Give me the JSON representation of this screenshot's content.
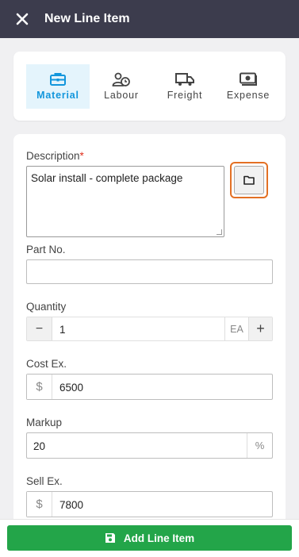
{
  "header": {
    "title": "New Line Item"
  },
  "types": {
    "active": "Material",
    "items": [
      {
        "label": "Material",
        "icon": "toolbox-icon"
      },
      {
        "label": "Labour",
        "icon": "worker-clock-icon"
      },
      {
        "label": "Freight",
        "icon": "truck-icon"
      },
      {
        "label": "Expense",
        "icon": "money-icon"
      }
    ]
  },
  "form": {
    "description": {
      "label": "Description",
      "required_mark": "*",
      "value": "Solar install - complete package"
    },
    "part_no": {
      "label": "Part No.",
      "value": ""
    },
    "quantity": {
      "label": "Quantity",
      "value": "1",
      "unit": "EA",
      "minus": "−",
      "plus": "+"
    },
    "cost_ex": {
      "label": "Cost Ex.",
      "prefix": "$",
      "value": "6500"
    },
    "markup": {
      "label": "Markup",
      "value": "20",
      "suffix": "%"
    },
    "sell_ex": {
      "label": "Sell Ex.",
      "prefix": "$",
      "value": "7800"
    }
  },
  "footer": {
    "add_label": "Add Line Item"
  },
  "colors": {
    "header_bg": "#3c3c4d",
    "accent": "#1296dc",
    "folder_border": "#e37024",
    "add_button": "#23a549"
  }
}
